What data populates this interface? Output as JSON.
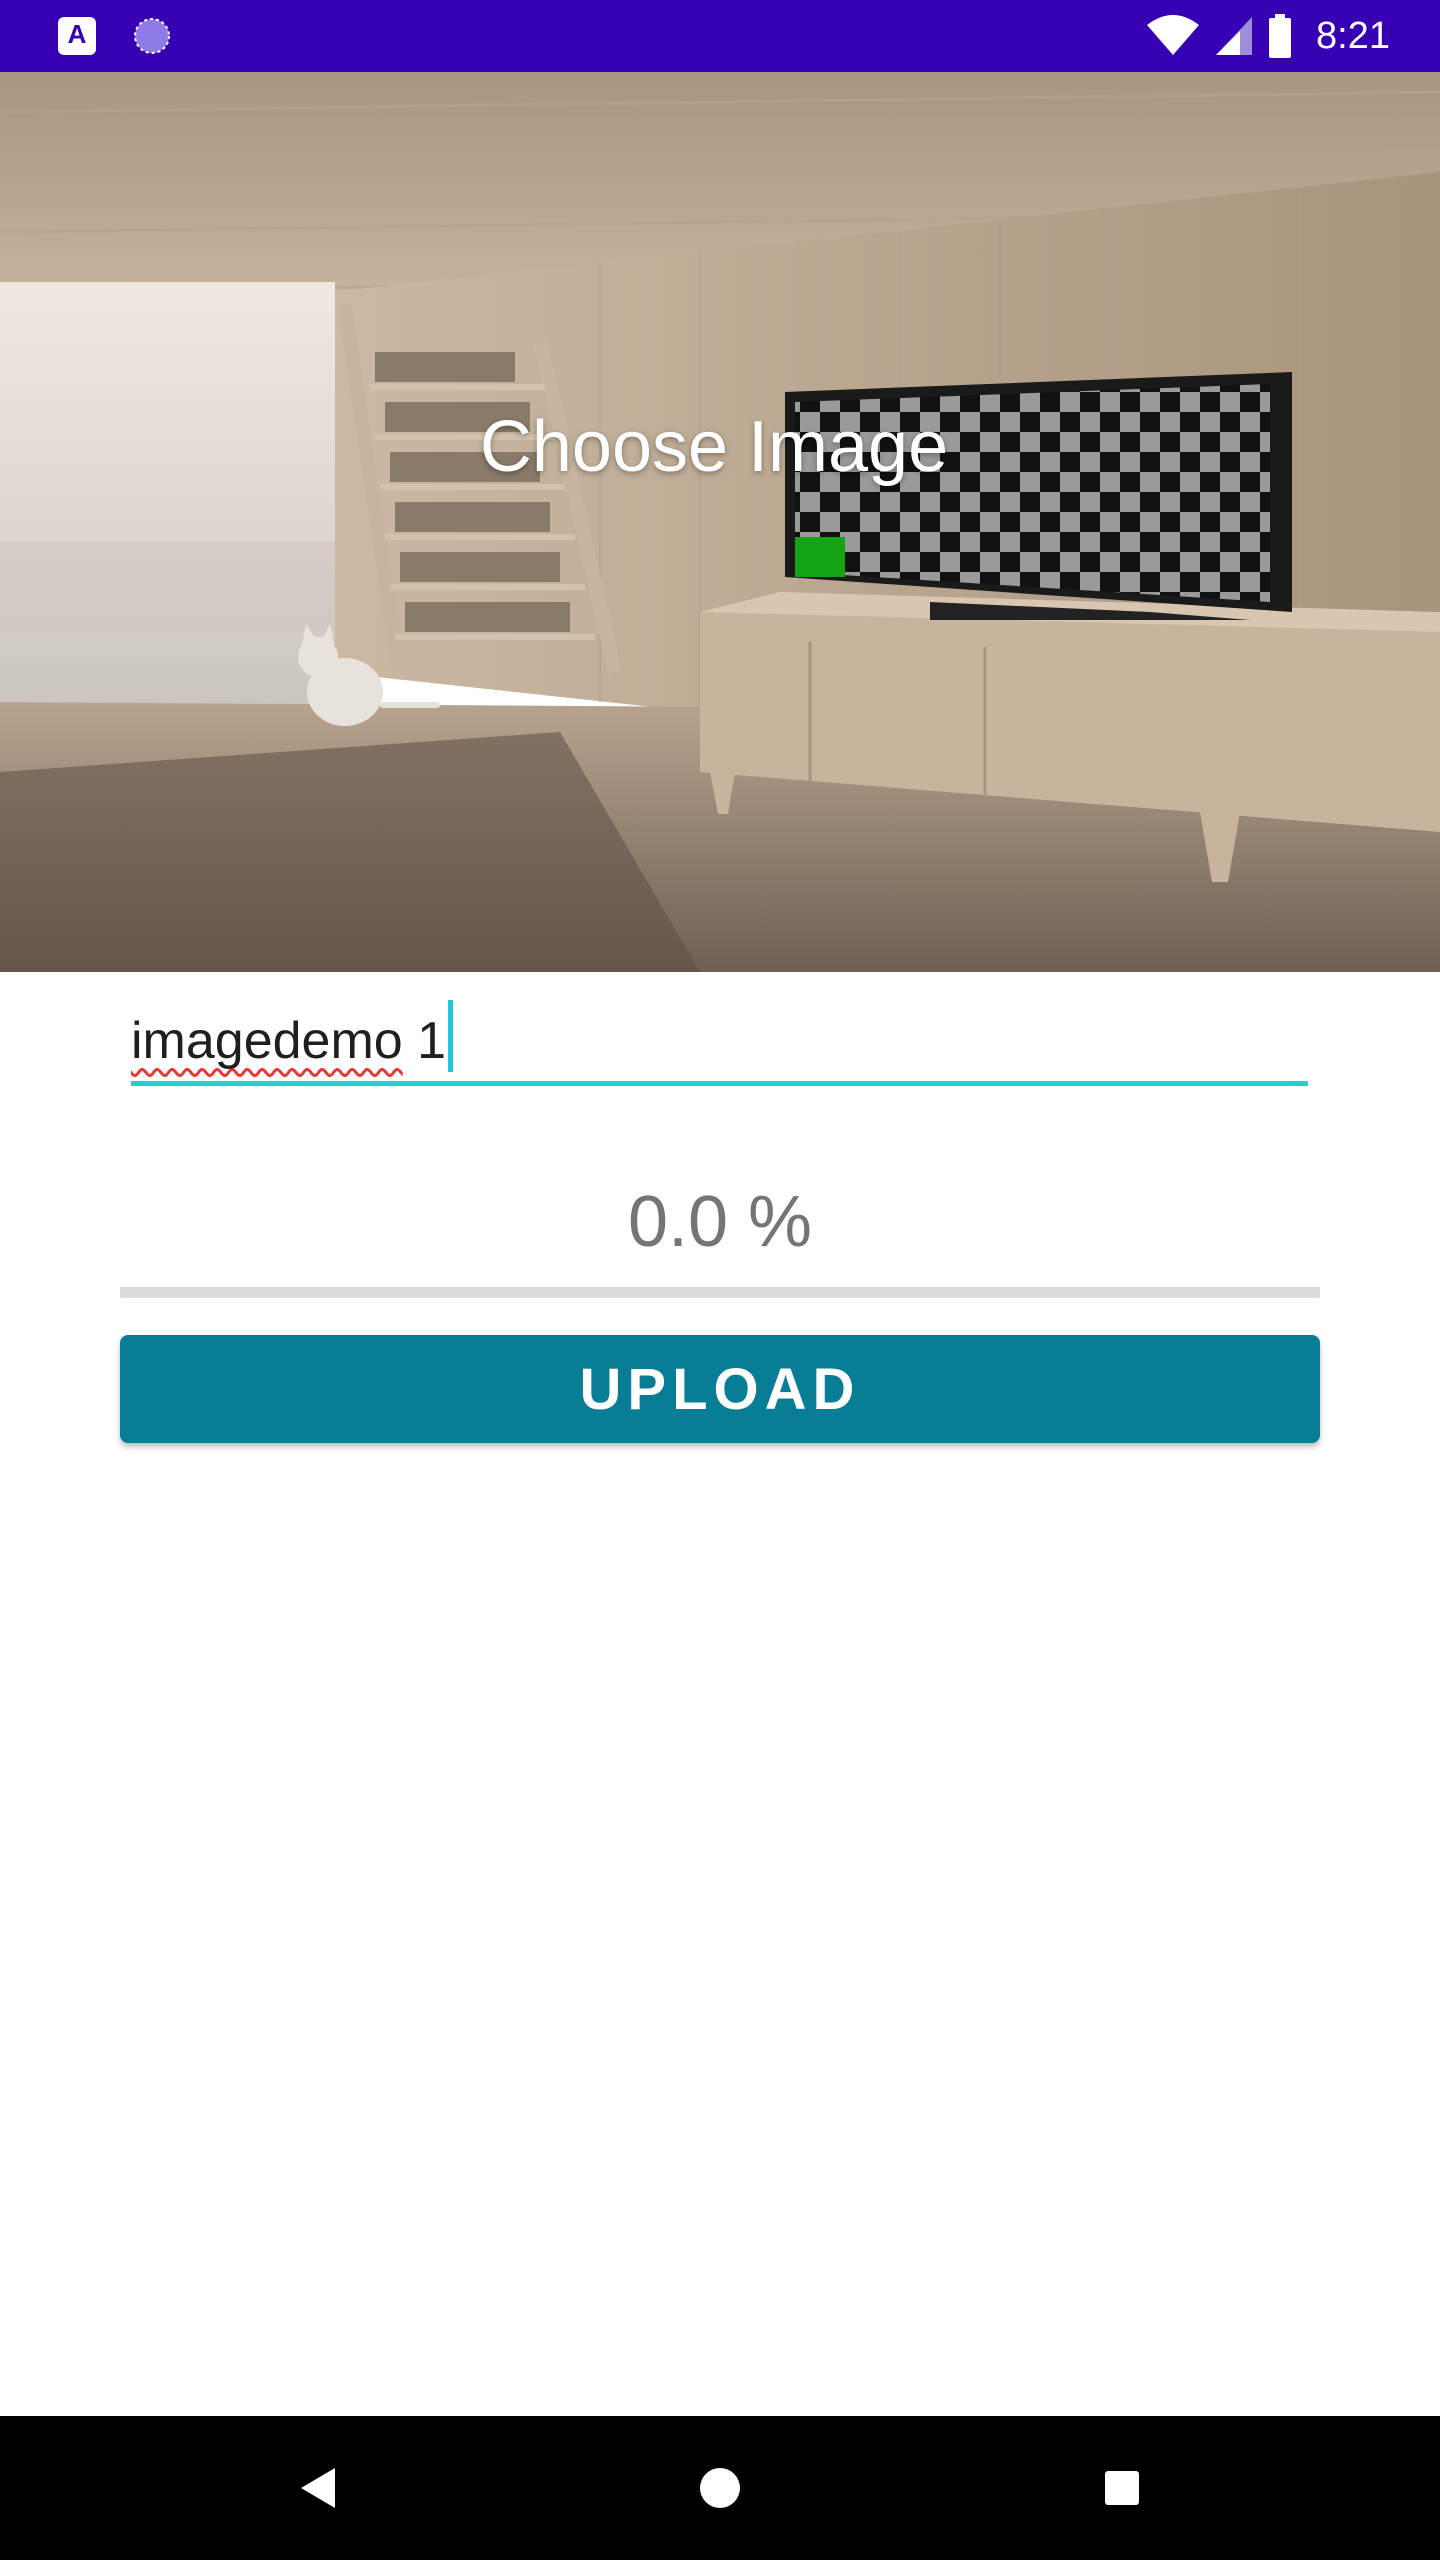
{
  "status_bar": {
    "time": "8:21",
    "background_color": "#3700b3",
    "left_icons": [
      "app-notification-icon",
      "loading-notification-icon"
    ],
    "app_icon_letter": "A",
    "right_icons": [
      "wifi-icon",
      "cellular-signal-icon",
      "battery-icon"
    ]
  },
  "image_picker": {
    "label": "Choose Image",
    "background": "room-scene-image"
  },
  "name_input": {
    "value": "imagedemo",
    "value_suffix": " 1",
    "underline_color": "#26d0c8"
  },
  "progress": {
    "text": "0.0 %",
    "value_percent": 0.0
  },
  "upload_button": {
    "label": "UPLOAD",
    "color": "#077e96"
  },
  "nav_bar": {
    "buttons": [
      "back-icon",
      "home-icon",
      "recents-icon"
    ]
  }
}
